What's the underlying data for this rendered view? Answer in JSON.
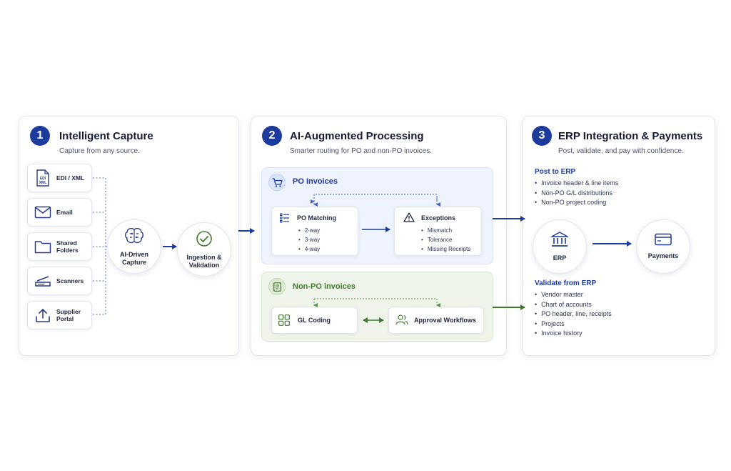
{
  "colors": {
    "accent": "#1d3b9c",
    "green": "#3f7a2c",
    "po_zone_bg": "#eef3fd",
    "nonpo_zone_bg": "#eff5ea"
  },
  "step1": {
    "number": "1",
    "title": "Intelligent Capture",
    "subtitle": "Capture from any source.",
    "sources": [
      {
        "label": "EDI / XML",
        "icon": "edi-xml-icon"
      },
      {
        "label": "Email",
        "icon": "email-icon"
      },
      {
        "label": "Shared Folders",
        "icon": "folder-icon"
      },
      {
        "label": "Scanners",
        "icon": "scanner-icon"
      },
      {
        "label": "Supplier Portal",
        "icon": "upload-icon"
      }
    ],
    "capture_label": "AI-Driven Capture",
    "validation_label": "Ingestion & Validation",
    "edi_icon_text": "EDI XML"
  },
  "step2": {
    "number": "2",
    "title": "AI-Augmented Processing",
    "subtitle": "Smarter routing for PO and non-PO invoices.",
    "po": {
      "title": "PO Invoices",
      "matching_title": "PO Matching",
      "matching_items": [
        "2-way",
        "3-way",
        "4-way"
      ],
      "exceptions_title": "Exceptions",
      "exceptions_items": [
        "Mismatch",
        "Tolerance",
        "Missing Receipts"
      ]
    },
    "nonpo": {
      "title": "Non-PO invoices",
      "gl_label": "GL Coding",
      "approval_label": "Approval Workflows"
    }
  },
  "step3": {
    "number": "3",
    "title": "ERP Integration & Payments",
    "subtitle": "Post, validate, and pay with confidence.",
    "post_title": "Post to ERP",
    "post_items": [
      "Invoice header & line items",
      "Non-PO G/L distributions",
      "Non-PO project coding"
    ],
    "erp_label": "ERP",
    "payments_label": "Payments",
    "validate_title": "Validate from ERP",
    "validate_items": [
      "Vendor master",
      "Chart of accounts",
      "PO header, line, receipts",
      "Projects",
      "Invoice history"
    ]
  }
}
